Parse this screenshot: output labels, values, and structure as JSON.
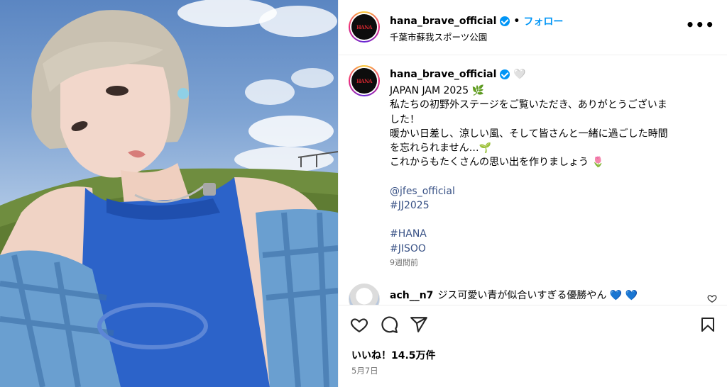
{
  "post": {
    "username": "hana_brave_official",
    "follow_label": "フォロー",
    "separator": "•",
    "location": "千葉市蘇我スポーツ公園",
    "more_label": "•••",
    "avatar_text": "HANA"
  },
  "caption": {
    "username": "hana_brave_official",
    "heart": "🤍",
    "lines": [
      "JAPAN JAM 2025 🌿",
      "私たちの初野外ステージをご覧いただき、ありがとうございま",
      "した！",
      "暖かい日差し、涼しい風、そして皆さんと一緒に過ごした時間",
      "を忘れられません…🌱",
      "これからもたくさんの思い出を作りましょう 🌷",
      "",
      "@jfes_official",
      "#JJ2025",
      "",
      "#HANA",
      "#JISOO"
    ],
    "time": "9週間前"
  },
  "comment": {
    "username": "ach__n7",
    "text": "ジス可愛い青が似合いすぎる優勝やん",
    "hearts": "💙 💙"
  },
  "actions": {
    "likes": "いいね！14.5万件",
    "date": "5月7日"
  },
  "colors": {
    "accent": "#0095f6",
    "link": "#385185",
    "muted": "#737373"
  }
}
